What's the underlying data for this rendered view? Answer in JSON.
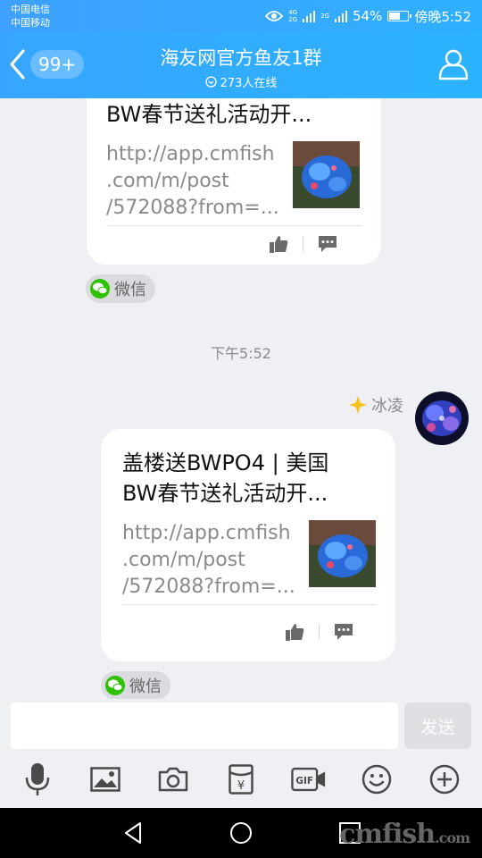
{
  "status": {
    "carrier1": "中国电信",
    "carrier2": "中国移动",
    "net1": "4G",
    "net1b": "2G",
    "net2": "2G",
    "battery": "54%",
    "time": "傍晚5:52"
  },
  "header": {
    "unread": "99+",
    "title": "海友网官方鱼友1群",
    "online": "273人在线",
    "accent": "#2fb0ff"
  },
  "messages": [
    {
      "title_partial": "BW春节送礼活动开...",
      "url_line1": "http://app.cmfish",
      "url_line2": ".com/m/post",
      "url_line3": "/572088?from=...",
      "source": "微信"
    }
  ],
  "time_divider": "下午5:52",
  "message2": {
    "sender": "冰凌",
    "title_line1": "盖楼送BWPO4 | 美国",
    "title_line2": "BW春节送礼活动开...",
    "url_line1": "http://app.cmfish",
    "url_line2": ".com/m/post",
    "url_line3": "/572088?from=...",
    "source": "微信"
  },
  "input": {
    "value": "",
    "send_label": "发送"
  },
  "watermark": {
    "main": "cmfish",
    "suffix": ".com"
  },
  "icons": [
    "back-icon",
    "group-profile-icon",
    "thumbs-up-icon",
    "comment-icon",
    "wechat-icon",
    "star-badge-icon",
    "mic-icon",
    "image-icon",
    "camera-icon",
    "red-packet-icon",
    "gif-icon",
    "emoji-icon",
    "plus-icon",
    "nav-back-icon",
    "nav-home-icon",
    "nav-recents-icon"
  ]
}
